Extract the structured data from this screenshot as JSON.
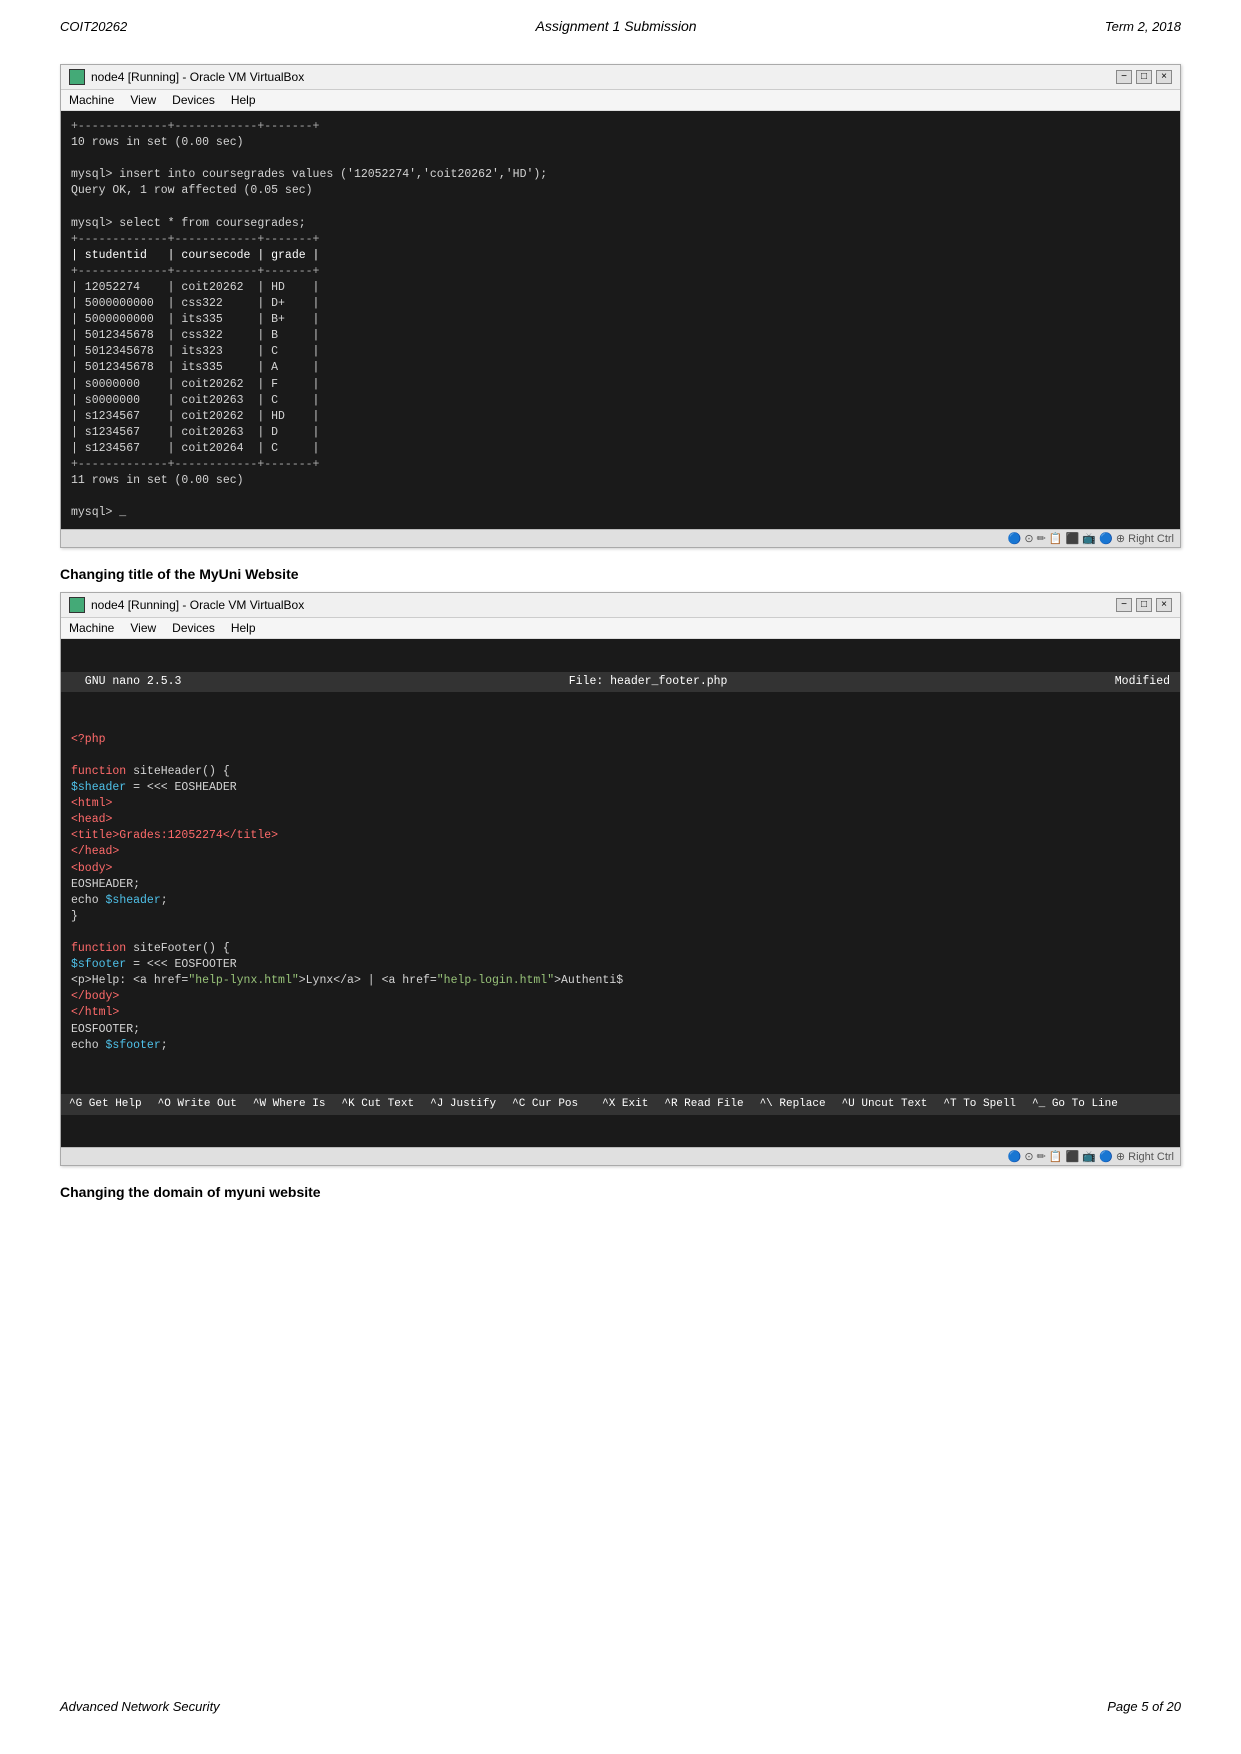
{
  "header": {
    "left": "COIT20262",
    "center": "Assignment 1 Submission",
    "right": "Term 2, 2018"
  },
  "footer": {
    "left": "Advanced Network Security",
    "right": "Page 5 of 20"
  },
  "section1": {
    "title": "",
    "vbox_title": "node4 [Running] - Oracle VM VirtualBox",
    "menu": [
      "Machine",
      "View",
      "Devices",
      "Help"
    ],
    "terminal_lines": [
      "+-------------+------------+-------+",
      "10 rows in set (0.00 sec)",
      "",
      "mysql> insert into coursegrades values ('12052274','coit20262','HD');",
      "Query OK, 1 row affected (0.05 sec)",
      "",
      "mysql> select * from coursegrades;",
      "+-------------+------------+-------+",
      "| studentid   | coursecode | grade |",
      "+-------------+------------+-------+",
      "| 12052274    | coit20262  | HD    |",
      "| 5000000000  | css322     | D+    |",
      "| 5000000000  | its335     | B+    |",
      "| 5012345678  | css322     | B     |",
      "| 5012345678  | its323     | C     |",
      "| 5012345678  | its335     | A     |",
      "| s0000000    | coit20262  | F     |",
      "| s0000000    | coit20263  | C     |",
      "| s1234567    | coit20262  | HD    |",
      "| s1234567    | coit20263  | D     |",
      "| s1234567    | coit20264  | C     |",
      "+-------------+------------+-------+",
      "11 rows in set (0.00 sec)",
      "",
      "mysql> _"
    ]
  },
  "section2": {
    "title": "Changing title of the MyUni Website",
    "vbox_title": "node4 [Running] - Oracle VM VirtualBox",
    "menu": [
      "Machine",
      "View",
      "Devices",
      "Help"
    ],
    "nano_header_left": "  GNU nano 2.5.3",
    "nano_header_center": "File: header_footer.php",
    "nano_header_right": "Modified",
    "nano_lines": [
      {
        "type": "php-tag",
        "text": "<?php"
      },
      {
        "type": "blank",
        "text": ""
      },
      {
        "type": "mixed",
        "parts": [
          {
            "cls": "php-keyword",
            "t": "function"
          },
          {
            "cls": "php-normal",
            "t": " siteHeader() {"
          }
        ]
      },
      {
        "type": "mixed",
        "parts": [
          {
            "cls": "php-var",
            "t": "$sheader"
          },
          {
            "cls": "php-normal",
            "t": " = <<< EOSHEADER"
          }
        ]
      },
      {
        "type": "php-html-tag",
        "text": "<html>"
      },
      {
        "type": "php-html-tag",
        "text": "<head>"
      },
      {
        "type": "php-html-tag",
        "text": "<title>Grades:12052274</title>"
      },
      {
        "type": "php-html-tag",
        "text": "</head>"
      },
      {
        "type": "php-html-tag",
        "text": "<body>"
      },
      {
        "type": "php-normal",
        "text": "EOSHEADER;"
      },
      {
        "type": "mixed",
        "parts": [
          {
            "cls": "php-normal",
            "t": "echo "
          },
          {
            "cls": "php-var",
            "t": "$sheader"
          },
          {
            "cls": "php-normal",
            "t": ";"
          }
        ]
      },
      {
        "type": "php-normal",
        "text": "}"
      },
      {
        "type": "blank",
        "text": ""
      },
      {
        "type": "mixed",
        "parts": [
          {
            "cls": "php-keyword",
            "t": "function"
          },
          {
            "cls": "php-normal",
            "t": " siteFooter() {"
          }
        ]
      },
      {
        "type": "mixed",
        "parts": [
          {
            "cls": "php-var",
            "t": "$sfooter"
          },
          {
            "cls": "php-normal",
            "t": " = <<< EOSFOOTER"
          }
        ]
      },
      {
        "type": "mixed",
        "parts": [
          {
            "cls": "php-normal",
            "t": "<p>Help: <a href="
          },
          {
            "cls": "php-string",
            "t": "\"help-lynx.html\""
          },
          {
            "cls": "php-normal",
            "t": ">Lynx</a> | <a href="
          },
          {
            "cls": "php-string",
            "t": "\"help-login.html\""
          },
          {
            "cls": "php-normal",
            "t": ">Authenti$"
          }
        ]
      },
      {
        "type": "php-html-tag",
        "text": "</body>"
      },
      {
        "type": "php-html-tag",
        "text": "</html>"
      },
      {
        "type": "php-normal",
        "text": "EOSFOOTER;"
      },
      {
        "type": "mixed",
        "parts": [
          {
            "cls": "php-normal",
            "t": "echo "
          },
          {
            "cls": "php-var",
            "t": "$sfooter"
          },
          {
            "cls": "php-normal",
            "t": ";"
          }
        ]
      }
    ],
    "nano_footer_row1": [
      "^G Get Help",
      "^O Write Out",
      "^W Where Is",
      "^K Cut Text",
      "^J Justify",
      "^C Cur Pos"
    ],
    "nano_footer_row2": [
      "^X Exit",
      "^R Read File",
      "^\\ Replace",
      "^U Uncut Text",
      "^T To Spell",
      "^_ Go To Line"
    ]
  },
  "section3": {
    "title": "Changing the domain of myuni website"
  },
  "buttons": {
    "minimize": "−",
    "maximize": "□",
    "close": "×"
  }
}
